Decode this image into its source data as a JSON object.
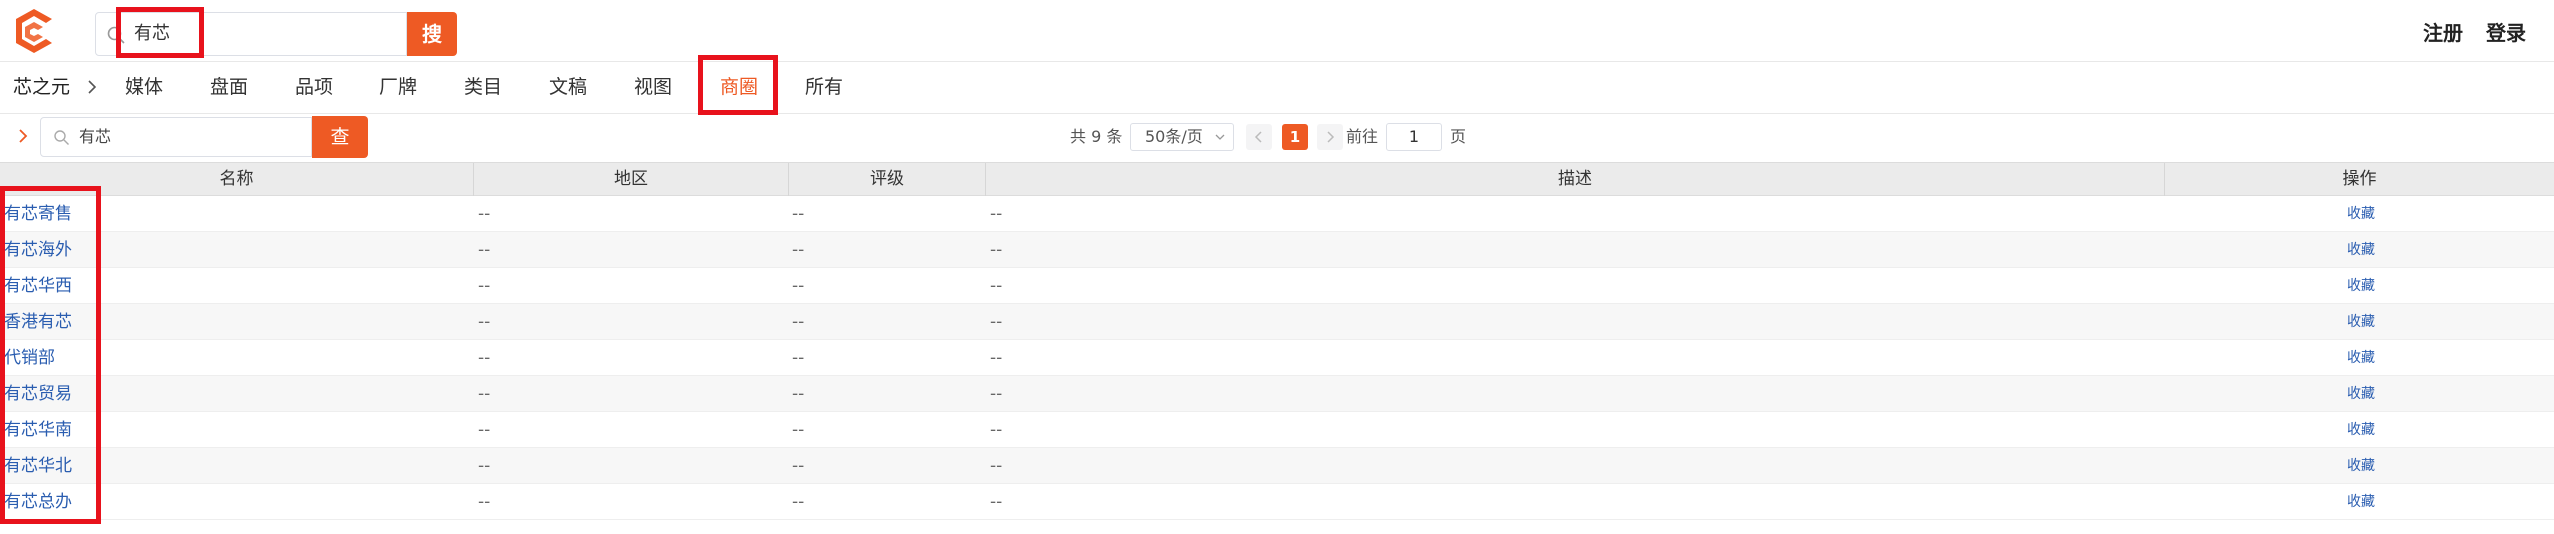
{
  "header": {
    "search": {
      "value": "有芯",
      "button_label": "搜"
    },
    "register_label": "注册",
    "login_label": "登录"
  },
  "nav": {
    "brand": "芯之元",
    "items": [
      {
        "label": "媒体"
      },
      {
        "label": "盘面"
      },
      {
        "label": "品项"
      },
      {
        "label": "厂牌"
      },
      {
        "label": "类目"
      },
      {
        "label": "文稿"
      },
      {
        "label": "视图"
      },
      {
        "label": "商圈",
        "active": true
      },
      {
        "label": "所有"
      }
    ]
  },
  "toolbar": {
    "filter": {
      "value": "有芯",
      "button_label": "查"
    },
    "pager": {
      "total_text": "共 9 条",
      "page_size": "50条/页",
      "current_page": "1",
      "goto_label": "前往",
      "goto_value": "1",
      "goto_suffix": "页"
    }
  },
  "table": {
    "columns": [
      "名称",
      "地区",
      "评级",
      "描述",
      "操作"
    ],
    "rows": [
      {
        "name": "有芯寄售",
        "region": "--",
        "rating": "--",
        "desc": "--",
        "op": "收藏"
      },
      {
        "name": "有芯海外",
        "region": "--",
        "rating": "--",
        "desc": "--",
        "op": "收藏"
      },
      {
        "name": "有芯华西",
        "region": "--",
        "rating": "--",
        "desc": "--",
        "op": "收藏"
      },
      {
        "name": "香港有芯",
        "region": "--",
        "rating": "--",
        "desc": "--",
        "op": "收藏"
      },
      {
        "name": "代销部",
        "region": "--",
        "rating": "--",
        "desc": "--",
        "op": "收藏"
      },
      {
        "name": "有芯贸易",
        "region": "--",
        "rating": "--",
        "desc": "--",
        "op": "收藏"
      },
      {
        "name": "有芯华南",
        "region": "--",
        "rating": "--",
        "desc": "--",
        "op": "收藏"
      },
      {
        "name": "有芯华北",
        "region": "--",
        "rating": "--",
        "desc": "--",
        "op": "收藏"
      },
      {
        "name": "有芯总办",
        "region": "--",
        "rating": "--",
        "desc": "--",
        "op": "收藏"
      }
    ]
  },
  "colors": {
    "accent": "#ee5a24",
    "link": "#2a5db0",
    "highlight": "#e8121c"
  },
  "icons": [
    "logo-icon",
    "search-icon",
    "chevron-right-icon",
    "caret-down-icon",
    "prev-page-icon",
    "next-page-icon"
  ]
}
